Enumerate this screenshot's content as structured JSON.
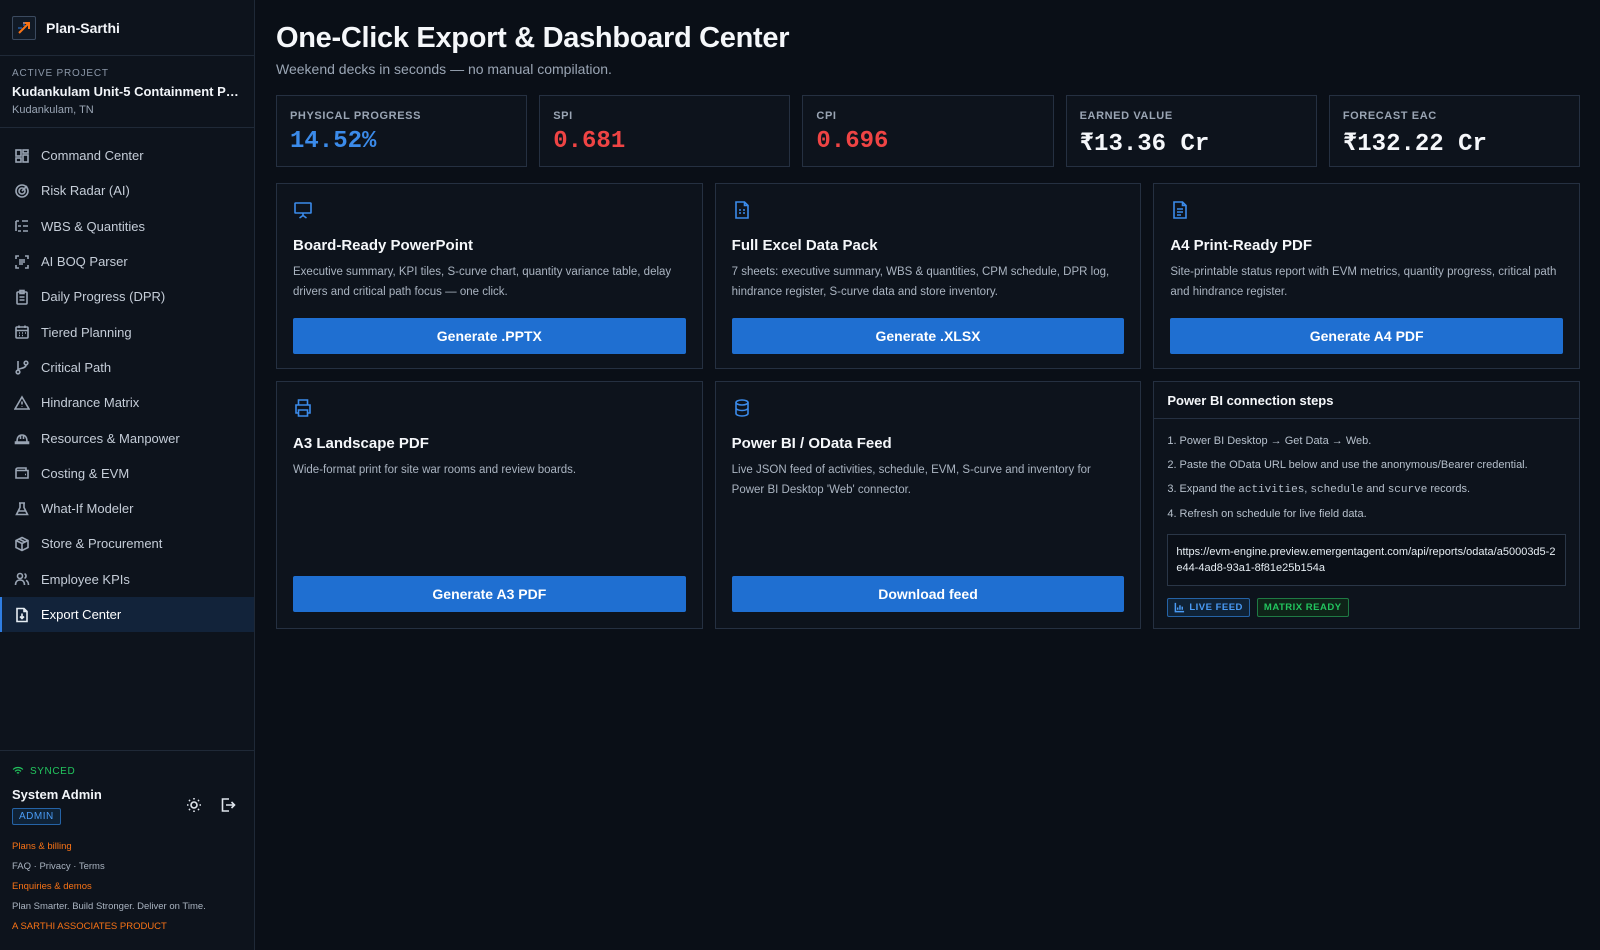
{
  "brand": {
    "name": "Plan-Sarthi"
  },
  "project": {
    "caption": "ACTIVE PROJECT",
    "name": "Kudankulam Unit-5 Containment Pa...",
    "location": "Kudankulam, TN"
  },
  "nav": {
    "items": [
      {
        "label": "Command Center",
        "icon": "grid-icon"
      },
      {
        "label": "Risk Radar (AI)",
        "icon": "radar-icon"
      },
      {
        "label": "WBS & Quantities",
        "icon": "list-tree-icon"
      },
      {
        "label": "AI BOQ Parser",
        "icon": "scan-text-icon"
      },
      {
        "label": "Daily Progress (DPR)",
        "icon": "clipboard-icon"
      },
      {
        "label": "Tiered Planning",
        "icon": "calendar-icon"
      },
      {
        "label": "Critical Path",
        "icon": "git-branch-icon"
      },
      {
        "label": "Hindrance Matrix",
        "icon": "warning-icon"
      },
      {
        "label": "Resources & Manpower",
        "icon": "hard-hat-icon"
      },
      {
        "label": "Costing & EVM",
        "icon": "wallet-icon"
      },
      {
        "label": "What-If Modeler",
        "icon": "flask-icon"
      },
      {
        "label": "Store & Procurement",
        "icon": "package-icon"
      },
      {
        "label": "Employee KPIs",
        "icon": "users-icon"
      },
      {
        "label": "Export Center",
        "icon": "file-download-icon",
        "active": true
      }
    ]
  },
  "footer": {
    "sync_status": "SYNCED",
    "user_name": "System Admin",
    "role": "ADMIN",
    "plans_link": "Plans & billing",
    "legal_links": "FAQ · Privacy · Terms",
    "enquiries_link": "Enquiries & demos",
    "tagline": "Plan Smarter. Build Stronger. Deliver on Time.",
    "product_line": "A SARTHI ASSOCIATES PRODUCT"
  },
  "header": {
    "title": "One-Click Export & Dashboard Center",
    "subtitle": "Weekend decks in seconds — no manual compilation."
  },
  "kpis": [
    {
      "label": "PHYSICAL PROGRESS",
      "value": "14.52%",
      "color": "#3b8bea"
    },
    {
      "label": "SPI",
      "value": "0.681",
      "color": "#ef4444"
    },
    {
      "label": "CPI",
      "value": "0.696",
      "color": "#ef4444"
    },
    {
      "label": "EARNED VALUE",
      "value": "₹13.36 Cr",
      "color": "#f5f7fa"
    },
    {
      "label": "FORECAST EAC",
      "value": "₹132.22 Cr",
      "color": "#f5f7fa"
    }
  ],
  "cards": [
    {
      "icon": "presentation-icon",
      "title": "Board-Ready PowerPoint",
      "description": "Executive summary, KPI tiles, S-curve chart, quantity variance table, delay drivers and critical path focus — one click.",
      "button": "Generate .PPTX"
    },
    {
      "icon": "spreadsheet-icon",
      "title": "Full Excel Data Pack",
      "description": "7 sheets: executive summary, WBS & quantities, CPM schedule, DPR log, hindrance register, S-curve data and store inventory.",
      "button": "Generate .XLSX"
    },
    {
      "icon": "document-icon",
      "title": "A4 Print-Ready PDF",
      "description": "Site-printable status report with EVM metrics, quantity progress, critical path and hindrance register.",
      "button": "Generate A4 PDF"
    },
    {
      "icon": "printer-icon",
      "title": "A3 Landscape PDF",
      "description": "Wide-format print for site war rooms and review boards.",
      "button": "Generate A3 PDF"
    },
    {
      "icon": "database-icon",
      "title": "Power BI / OData Feed",
      "description": "Live JSON feed of activities, schedule, EVM, S-curve and inventory for Power BI Desktop 'Web' connector.",
      "button": "Download feed"
    }
  ],
  "powerbi": {
    "title": "Power BI connection steps",
    "step1": "1. Power BI Desktop → Get Data → Web.",
    "step2": "2. Paste the OData URL below and use the anonymous/Bearer credential.",
    "step3_prefix": "3. Expand the ",
    "step3_code1": "activities",
    "step3_sep1": ", ",
    "step3_code2": "schedule",
    "step3_sep2": " and ",
    "step3_code3": "scurve",
    "step3_suffix": " records.",
    "step4": "4. Refresh on schedule for live field data.",
    "url": "https://evm-engine.preview.emergentagent.com/api/reports/odata/a50003d5-2e44-4ad8-93a1-8f81e25b154a",
    "tag_live": "LIVE FEED",
    "tag_matrix": "MATRIX READY"
  }
}
